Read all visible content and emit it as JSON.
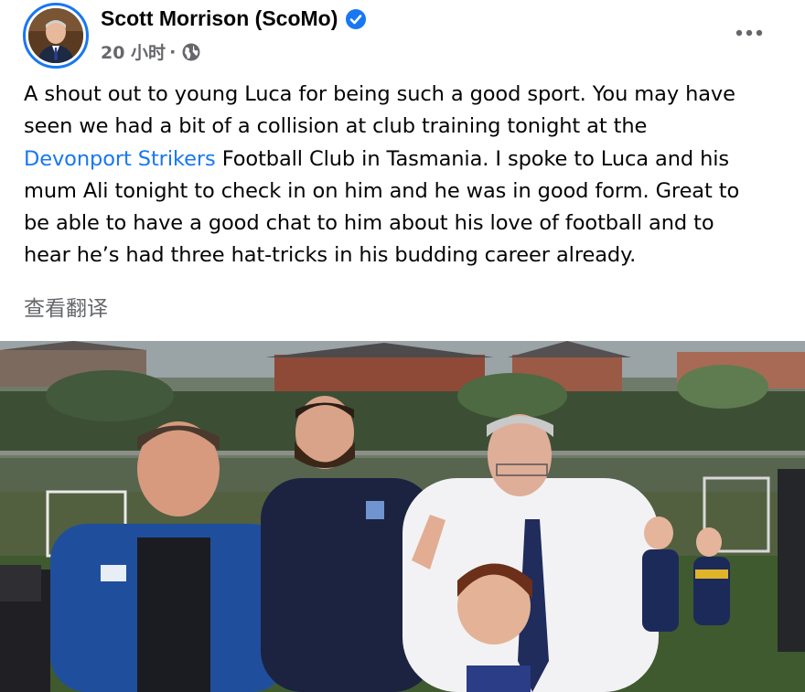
{
  "post": {
    "author_name": "Scott Morrison (ScoMo)",
    "timestamp": "20 小时",
    "separator": "·",
    "privacy_icon": "globe-icon",
    "verified_icon": "verified-badge-icon",
    "more_icon": "more-options-icon",
    "text_lines": [
      {
        "pre": "A shout out to young Luca for being such a good sport. You may have"
      },
      {
        "pre": "seen we had a bit of a collision at club training tonight at the"
      },
      {
        "link": "Devonport Strikers",
        "post": " Football Club in Tasmania. I spoke to Luca and his"
      },
      {
        "pre": "mum Ali tonight to check in on him and he was in good form. Great to"
      },
      {
        "pre": "be able to have a good chat to him about his love of football and to"
      },
      {
        "pre": "hear he’s had three hat-tricks in his budding career already."
      }
    ],
    "translate_label": "查看翻译"
  },
  "colors": {
    "link": "#1877f2",
    "secondary_text": "#65676b",
    "verified": "#1877f2"
  }
}
